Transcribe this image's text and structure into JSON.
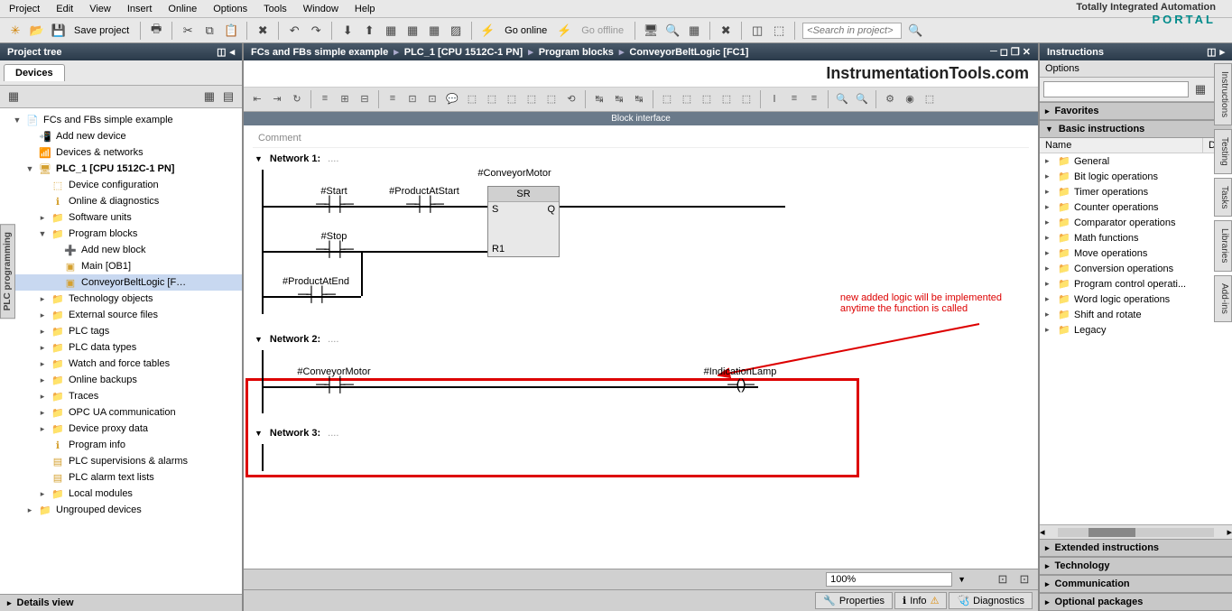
{
  "menu": [
    "Project",
    "Edit",
    "View",
    "Insert",
    "Online",
    "Options",
    "Tools",
    "Window",
    "Help"
  ],
  "brand": {
    "t1": "Totally Integrated Automation",
    "t2": "PORTAL"
  },
  "toolbar": {
    "save": "Save project",
    "go_online": "Go online",
    "go_offline": "Go offline",
    "search_ph": "<Search in project>"
  },
  "left": {
    "title": "Project tree",
    "tab": "Devices",
    "tree": [
      {
        "ind": 1,
        "caret": "▼",
        "icon": "📄",
        "label": "FCs and FBs simple example"
      },
      {
        "ind": 2,
        "caret": "",
        "icon": "📲",
        "label": "Add new device"
      },
      {
        "ind": 2,
        "caret": "",
        "icon": "📶",
        "label": "Devices & networks"
      },
      {
        "ind": 2,
        "caret": "▼",
        "icon": "🖥",
        "label": "PLC_1 [CPU 1512C-1 PN]",
        "bold": true
      },
      {
        "ind": 3,
        "caret": "",
        "icon": "⬚",
        "label": "Device configuration"
      },
      {
        "ind": 3,
        "caret": "",
        "icon": "ℹ",
        "label": "Online & diagnostics"
      },
      {
        "ind": 3,
        "caret": "▸",
        "icon": "📁",
        "label": "Software units"
      },
      {
        "ind": 3,
        "caret": "▼",
        "icon": "📁",
        "label": "Program blocks"
      },
      {
        "ind": 4,
        "caret": "",
        "icon": "➕",
        "label": "Add new block"
      },
      {
        "ind": 4,
        "caret": "",
        "icon": "▣",
        "label": "Main [OB1]"
      },
      {
        "ind": 4,
        "caret": "",
        "icon": "▣",
        "label": "ConveyorBeltLogic [F…",
        "sel": true
      },
      {
        "ind": 3,
        "caret": "▸",
        "icon": "📁",
        "label": "Technology objects"
      },
      {
        "ind": 3,
        "caret": "▸",
        "icon": "📁",
        "label": "External source files"
      },
      {
        "ind": 3,
        "caret": "▸",
        "icon": "📁",
        "label": "PLC tags"
      },
      {
        "ind": 3,
        "caret": "▸",
        "icon": "📁",
        "label": "PLC data types"
      },
      {
        "ind": 3,
        "caret": "▸",
        "icon": "📁",
        "label": "Watch and force tables"
      },
      {
        "ind": 3,
        "caret": "▸",
        "icon": "📁",
        "label": "Online backups"
      },
      {
        "ind": 3,
        "caret": "▸",
        "icon": "📁",
        "label": "Traces"
      },
      {
        "ind": 3,
        "caret": "▸",
        "icon": "📁",
        "label": "OPC UA communication"
      },
      {
        "ind": 3,
        "caret": "▸",
        "icon": "📁",
        "label": "Device proxy data"
      },
      {
        "ind": 3,
        "caret": "",
        "icon": "ℹ",
        "label": "Program info"
      },
      {
        "ind": 3,
        "caret": "",
        "icon": "▤",
        "label": "PLC supervisions & alarms"
      },
      {
        "ind": 3,
        "caret": "",
        "icon": "▤",
        "label": "PLC alarm text lists"
      },
      {
        "ind": 3,
        "caret": "▸",
        "icon": "📁",
        "label": "Local modules"
      },
      {
        "ind": 2,
        "caret": "▸",
        "icon": "📁",
        "label": "Ungrouped devices"
      }
    ],
    "details": "Details view",
    "side_tab": "PLC programming"
  },
  "center": {
    "crumbs": [
      "FCs and FBs simple example",
      "PLC_1 [CPU 1512C-1 PN]",
      "Program blocks",
      "ConveyorBeltLogic [FC1]"
    ],
    "watermark": "InstrumentationTools.com",
    "block_iface": "Block interface",
    "comment": "Comment",
    "net1": "Network 1:",
    "net2": "Network 2:",
    "net3": "Network 3:",
    "tags": {
      "start": "#Start",
      "prodStart": "#ProductAtStart",
      "stop": "#Stop",
      "prodEnd": "#ProductAtEnd",
      "convMotor": "#ConveyorMotor",
      "indLamp": "#IndicationLamp"
    },
    "sr": {
      "title": "SR",
      "s": "S",
      "q": "Q",
      "r1": "R1"
    },
    "anno": {
      "l1": "new added logic will be implemented",
      "l2": "anytime the function is called"
    },
    "zoom": "100%",
    "tabs": {
      "props": "Properties",
      "info": "Info",
      "diag": "Diagnostics"
    }
  },
  "right": {
    "title": "Instructions",
    "options": "Options",
    "sections": {
      "fav": "Favorites",
      "basic": "Basic instructions",
      "ext": "Extended instructions",
      "tech": "Technology",
      "comm": "Communication",
      "opt": "Optional packages"
    },
    "cols": {
      "name": "Name",
      "desc": "De..."
    },
    "items": [
      "General",
      "Bit logic operations",
      "Timer operations",
      "Counter operations",
      "Comparator operations",
      "Math functions",
      "Move operations",
      "Conversion operations",
      "Program control operati...",
      "Word logic operations",
      "Shift and rotate",
      "Legacy"
    ]
  },
  "side_tabs_r": [
    "Instructions",
    "Testing",
    "Tasks",
    "Libraries",
    "Add-ins"
  ]
}
